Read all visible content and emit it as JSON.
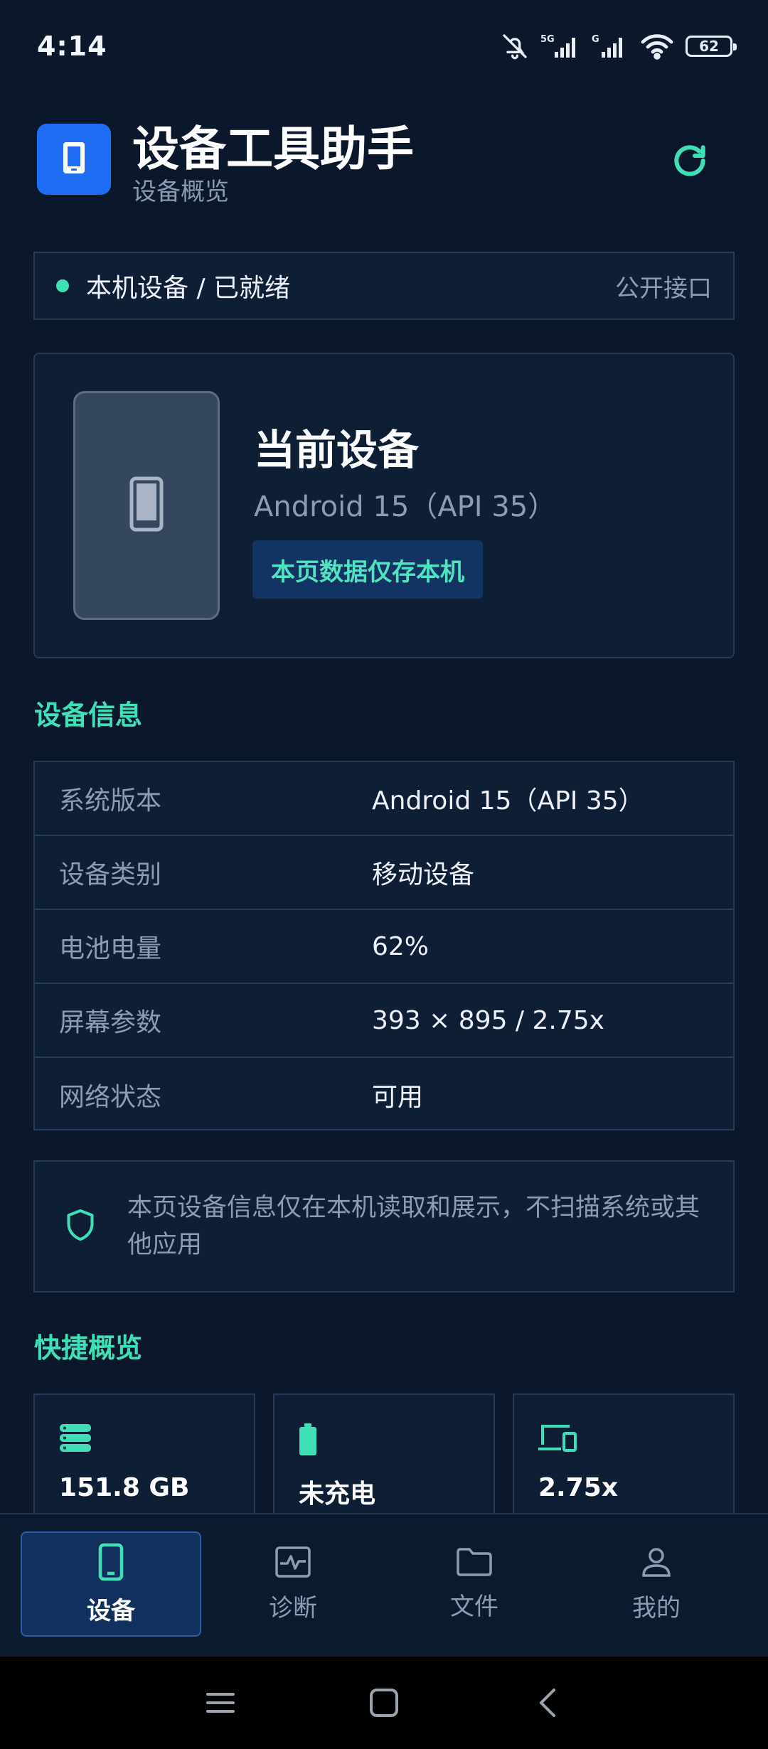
{
  "status_bar": {
    "time": "4:14",
    "battery_level": "62",
    "icons": [
      "mute-icon",
      "5g-signal-icon",
      "g-signal-icon",
      "wifi-icon",
      "battery-icon"
    ]
  },
  "header": {
    "title": "设备工具助手",
    "subtitle": "设备概览",
    "logo_icon": "phone-icon",
    "refresh_icon": "refresh-icon"
  },
  "status_strip": {
    "text": "本机设备 / 已就绪",
    "link": "公开接口"
  },
  "device_card": {
    "name": "当前设备",
    "os": "Android 15（API 35）",
    "chip": "本页数据仅存本机"
  },
  "sections": {
    "info_title": "设备信息",
    "quick_title": "快捷概览"
  },
  "device_info": [
    {
      "label": "系统版本",
      "value": "Android 15（API 35）"
    },
    {
      "label": "设备类别",
      "value": "移动设备"
    },
    {
      "label": "电池电量",
      "value": "62%"
    },
    {
      "label": "屏幕参数",
      "value": "393 × 895 / 2.75x"
    },
    {
      "label": "网络状态",
      "value": "可用"
    }
  ],
  "notice": {
    "text": "本页设备信息仅在本机读取和展示，不扫描系统或其他应用",
    "icon": "shield-icon"
  },
  "quick_cards": [
    {
      "icon": "storage-icon",
      "value": "151.8 GB"
    },
    {
      "icon": "battery-icon",
      "value": "未充电"
    },
    {
      "icon": "devices-icon",
      "value": "2.75x"
    }
  ],
  "bottom_nav": [
    {
      "label": "设备",
      "icon": "phone-icon",
      "active": true
    },
    {
      "label": "诊断",
      "icon": "pulse-icon",
      "active": false
    },
    {
      "label": "文件",
      "icon": "folder-icon",
      "active": false
    },
    {
      "label": "我的",
      "icon": "person-icon",
      "active": false
    }
  ],
  "colors": {
    "background": "#0b182c",
    "accent": "#3fe0b5",
    "primary_blue": "#1f6df2",
    "card": "#0e1e35",
    "border": "#253a58"
  }
}
